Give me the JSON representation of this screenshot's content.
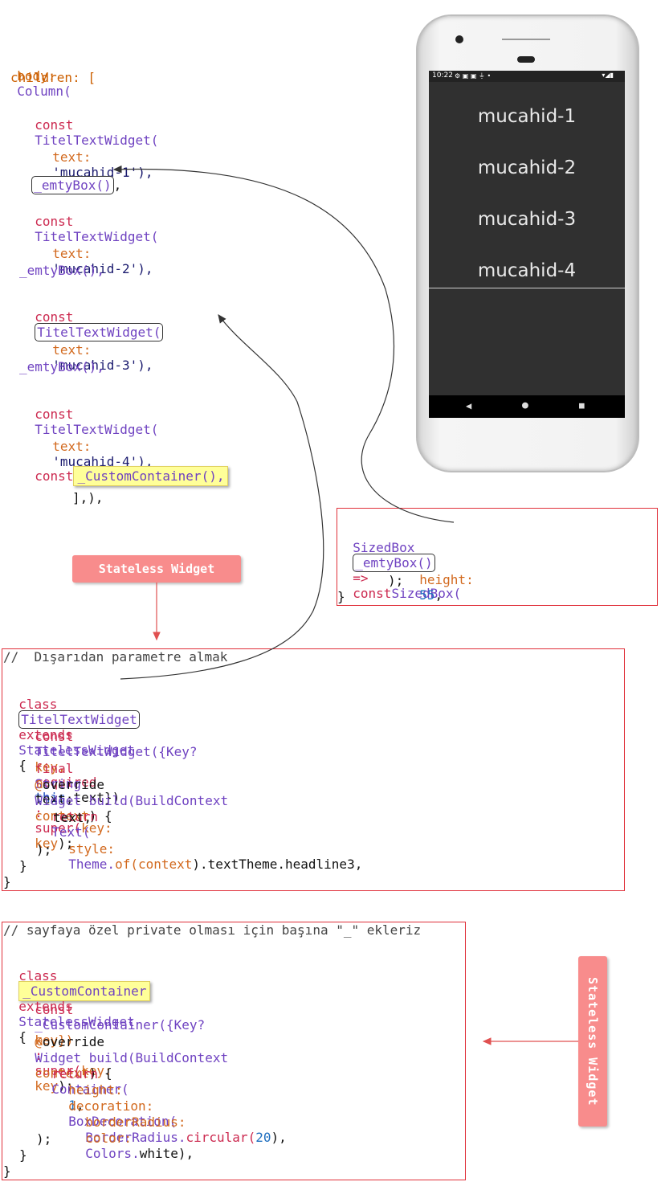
{
  "code_top": {
    "line1_kw": "body:",
    "line1_cls": "Column(",
    "line2": "children: [",
    "widget1_const": "const",
    "widget1_cls": "TitelTextWidget(",
    "text1_prm": "text:",
    "text1_str": "'mucahid-1'),",
    "empty1": "_emtyBox()",
    "empty1_tail": ",",
    "widget2_const": "const",
    "widget2_cls": "TitelTextWidget(",
    "text2_prm": "text:",
    "text2_str": "'mucahid-2'),",
    "empty2": "_emtyBox(),",
    "widget3_const": "const",
    "widget3_cls": "TitelTextWidget(",
    "text3_prm": "text:",
    "text3_str": "'mucahid-3'),",
    "empty3": "_emtyBox(),",
    "widget4_const": "const",
    "widget4_cls": "TitelTextWidget(",
    "text4_prm": "text:",
    "text4_str": "'mucahid-4'),",
    "custom_const": "const",
    "custom_call": "_CustomContainer(),",
    "closing": "],),"
  },
  "phone": {
    "status_time": "10:22",
    "status_icons_left": "⚙ ▣ ▣ ⏚ •",
    "status_icons_right": "▾◢▮",
    "items": [
      "mucahid-1",
      "mucahid-2",
      "mucahid-3",
      "mucahid-4"
    ],
    "nav_back": "◀",
    "nav_home": "●",
    "nav_recent": "■"
  },
  "sizedbox": {
    "type": "SizedBox",
    "name": "_emtyBox()",
    "arrow": "=>",
    "const": "const",
    "ctor": "SizedBox(",
    "height_label": "height:",
    "height_value": "55",
    "height_tail": ",",
    "close1": ");",
    "close2": "}"
  },
  "labels": {
    "stateless_top": "Stateless Widget",
    "stateless_right": "Stateless Widget"
  },
  "titel_class": {
    "comment": "//  Dışarıdan parametre almak",
    "class_kw": "class",
    "class_name": "TitelTextWidget",
    "extends_kw": "extends",
    "extends_cls": "StatelessWidget",
    "brace": "{",
    "ctor_const": "const",
    "ctor_name": "TitelTextWidget({Key?",
    "ctor_key": "key,",
    "ctor_required": "required",
    "ctor_this": "this",
    "ctor_text": ".text})",
    "ctor_colon": ":",
    "ctor_super": "super(",
    "ctor_key2": "key:",
    "ctor_key3": "key",
    "ctor_end": ");",
    "final_kw": "final",
    "final_type": "String",
    "final_name": "text;",
    "at": "@",
    "override": "override",
    "build_widget": "Widget build(BuildContext",
    "build_ctx": "context",
    "build_end": ") {",
    "return_kw": "return",
    "return_cls": "Text(",
    "text_line": "text,",
    "style_prm": "style:",
    "style_theme": "Theme.",
    "style_of": "of(",
    "style_ctx": "context",
    "style_end": ").textTheme.headline3,",
    "close_paren": ");",
    "close_inner": "}",
    "close_outer": "}"
  },
  "custom_class": {
    "comment": "// sayfaya özel private olması için başına \"_\" ekleriz",
    "class_kw": "class",
    "class_name": "_CustomContainer",
    "extends_kw": "extends",
    "extends_cls": "StatelessWidget",
    "brace": "{",
    "ctor_const": "const",
    "ctor_name": "_CustomContainer({Key?",
    "ctor_key": "key})",
    "ctor_colon": ":",
    "ctor_super": "super(",
    "ctor_key2": "key:",
    "ctor_key3": "key",
    "ctor_end": ");",
    "at": "@",
    "override": "override",
    "build_widget": "Widget build(BuildContext",
    "build_ctx": "context",
    "build_end": ") {",
    "return_kw": "return",
    "return_cls": "Container(",
    "height_prm": "height:",
    "height_val": "1",
    "height_tail": ",",
    "deco_prm": "decoration:",
    "deco_cls": "BoxDecoration(",
    "br_prm": "borderRadius:",
    "br_cls": "BorderRadius.",
    "br_fn": "circular(",
    "br_val": "20",
    "br_end": "),",
    "color_prm": "color:",
    "color_cls": "Colors.",
    "color_val": "white),",
    "close_paren": ");",
    "close_inner": "}",
    "close_outer": "}"
  }
}
